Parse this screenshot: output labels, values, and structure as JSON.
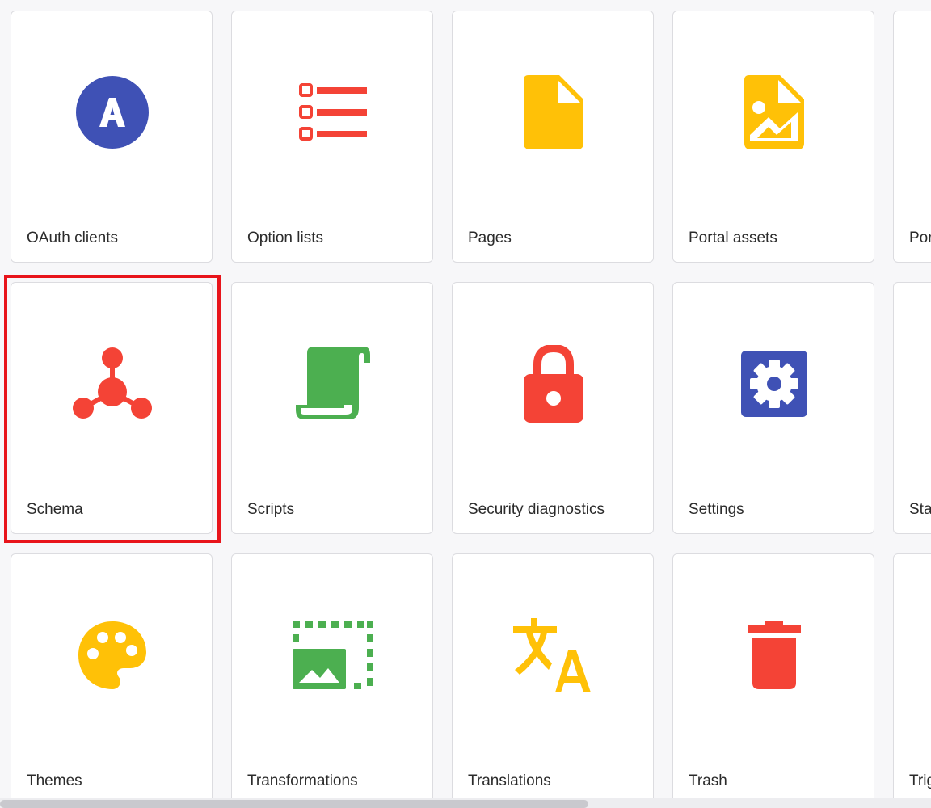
{
  "colors": {
    "blue": "#3f51b5",
    "red": "#f44336",
    "yellow": "#ffc107",
    "green": "#4caf50",
    "selection": "#e8141b"
  },
  "tiles": [
    {
      "label": "OAuth clients",
      "icon": "oauth-icon"
    },
    {
      "label": "Option lists",
      "icon": "list-icon"
    },
    {
      "label": "Pages",
      "icon": "page-icon"
    },
    {
      "label": "Portal assets",
      "icon": "image-file-icon"
    },
    {
      "label": "Por",
      "icon": ""
    },
    {
      "label": "Schema",
      "icon": "schema-icon",
      "selected": true
    },
    {
      "label": "Scripts",
      "icon": "script-icon"
    },
    {
      "label": "Security diagnostics",
      "icon": "lock-icon"
    },
    {
      "label": "Settings",
      "icon": "settings-gear-icon"
    },
    {
      "label": "Sta",
      "icon": ""
    },
    {
      "label": "Themes",
      "icon": "palette-icon"
    },
    {
      "label": "Transformations",
      "icon": "transform-icon"
    },
    {
      "label": "Translations",
      "icon": "translate-icon"
    },
    {
      "label": "Trash",
      "icon": "trash-icon"
    },
    {
      "label": "Trig",
      "icon": ""
    }
  ]
}
